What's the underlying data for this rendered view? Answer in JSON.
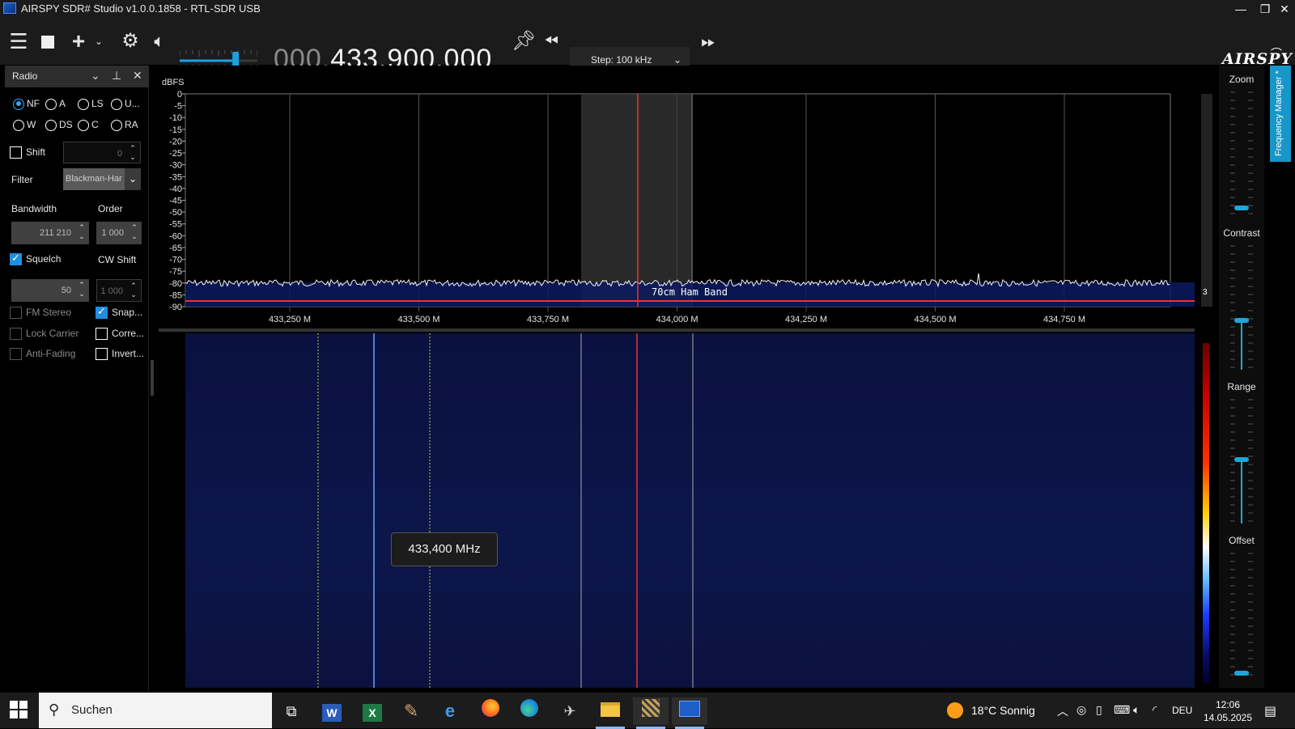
{
  "window": {
    "title": "AIRSPY SDR# Studio v1.0.0.1858 - RTL-SDR USB",
    "controls": {
      "minimize": "—",
      "restore": "❐",
      "close": "✕"
    }
  },
  "toolbar": {
    "frequency_dim": "000.",
    "frequency_main": "433.900.000",
    "step_label": "Step: 100 kHz",
    "volume_level": 0.72,
    "logo": "AIRSPY"
  },
  "radio_panel": {
    "title": "Radio",
    "modes": [
      {
        "label": "NF",
        "selected": true
      },
      {
        "label": "A",
        "selected": false
      },
      {
        "label": "LS",
        "selected": false
      },
      {
        "label": "U...",
        "selected": false
      },
      {
        "label": "W",
        "selected": false
      },
      {
        "label": "DS",
        "selected": false
      },
      {
        "label": "C",
        "selected": false
      },
      {
        "label": "RA",
        "selected": false
      }
    ],
    "shift": {
      "label": "Shift",
      "checked": false,
      "value": "0"
    },
    "filter": {
      "label": "Filter",
      "value": "Blackman-Har"
    },
    "bandwidth": {
      "label": "Bandwidth",
      "value": "211 210"
    },
    "order": {
      "label": "Order",
      "value": "1 000"
    },
    "squelch": {
      "label": "Squelch",
      "checked": true,
      "value": "50"
    },
    "cw_shift": {
      "label": "CW Shift",
      "value": "1 000"
    },
    "options": [
      {
        "label": "FM Stereo",
        "checked": false,
        "enabled": false
      },
      {
        "label": "Snap...",
        "checked": true,
        "enabled": true
      },
      {
        "label": "Lock Carrier",
        "checked": false,
        "enabled": false
      },
      {
        "label": "Corre...",
        "checked": false,
        "enabled": true
      },
      {
        "label": "Anti-Fading",
        "checked": false,
        "enabled": false
      },
      {
        "label": "Invert...",
        "checked": false,
        "enabled": true
      }
    ]
  },
  "spectrum": {
    "y_unit": "dBFS",
    "y_ticks": [
      "0",
      "-5",
      "-10",
      "-15",
      "-20",
      "-25",
      "-30",
      "-35",
      "-40",
      "-45",
      "-50",
      "-55",
      "-60",
      "-65",
      "-70",
      "-75",
      "-80",
      "-85",
      "-90"
    ],
    "x_ticks": [
      "433,250 M",
      "433,500 M",
      "433,750 M",
      "434,000 M",
      "434,250 M",
      "434,500 M",
      "434,750 M"
    ],
    "band_label": "70cm Ham Band",
    "side_value": "3",
    "noise_floor_dbfs": -80,
    "squelch_line_dbfs": -88
  },
  "waterfall": {
    "tooltip": "433,400 MHz"
  },
  "right_panel": {
    "zoom": "Zoom",
    "contrast": "Contrast",
    "range": "Range",
    "offset": "Offset",
    "freq_manager_tab": "Frequency Manager *"
  },
  "taskbar": {
    "search_placeholder": "Suchen",
    "weather": "18°C Sonnig",
    "language": "DEU",
    "time": "12:06",
    "date": "14.05.2025"
  }
}
